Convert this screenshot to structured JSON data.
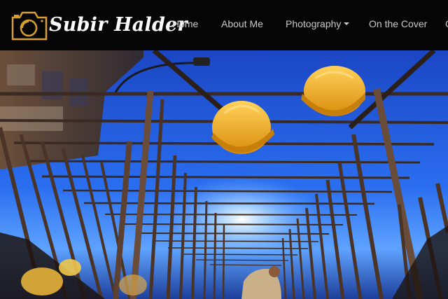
{
  "brand": {
    "name": "Subir Halder",
    "logo_icon": "camera-icon"
  },
  "nav": {
    "items": [
      {
        "label": "Home"
      },
      {
        "label": "About Me"
      },
      {
        "label": "Photography",
        "has_dropdown": true
      },
      {
        "label": "On the Cover"
      },
      {
        "label": "C"
      }
    ]
  },
  "hero": {
    "subject": "construction workers beneath rebar grid with yellow hard hats against blue sky"
  },
  "colors": {
    "navbar_bg": "#050505",
    "brand_gold": "#d9a02c",
    "nav_text": "#c9c9c9",
    "sky_blue": "#1f5ee0",
    "helmet_yellow": "#f0b21e"
  }
}
